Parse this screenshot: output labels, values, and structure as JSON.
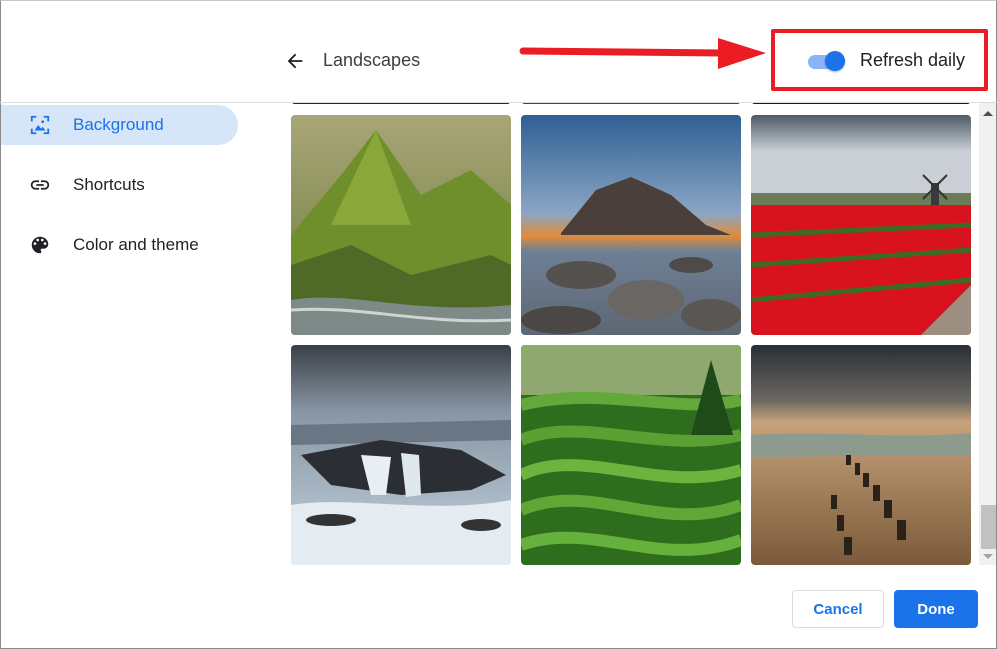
{
  "header": {
    "back_icon": "arrow-left-icon",
    "title": "Landscapes",
    "toggle": {
      "label": "Refresh daily",
      "on": true
    }
  },
  "sidebar": {
    "items": [
      {
        "label": "Background",
        "icon": "image-frame-icon",
        "active": true
      },
      {
        "label": "Shortcuts",
        "icon": "link-icon",
        "active": false
      },
      {
        "label": "Color and theme",
        "icon": "palette-icon",
        "active": false
      }
    ]
  },
  "gallery": {
    "images": [
      {
        "description": "Green mossy mountain peak with river delta"
      },
      {
        "description": "Rocky coastline at sunset with long-exposure sky"
      },
      {
        "description": "Red tulip field with windmill under cloudy sky"
      },
      {
        "description": "Ocean water pouring into rocky sinkhole"
      },
      {
        "description": "Terraced green tea plantation with trees"
      },
      {
        "description": "Beach with old wooden pier posts at dusk"
      }
    ]
  },
  "footer": {
    "cancel_label": "Cancel",
    "done_label": "Done"
  },
  "annotation": {
    "color": "#ec1c24",
    "target": "Refresh daily toggle"
  },
  "colors": {
    "accent": "#1a73e8",
    "active_bg": "#d7e5f8",
    "toggle_track": "#8ab4f8"
  }
}
